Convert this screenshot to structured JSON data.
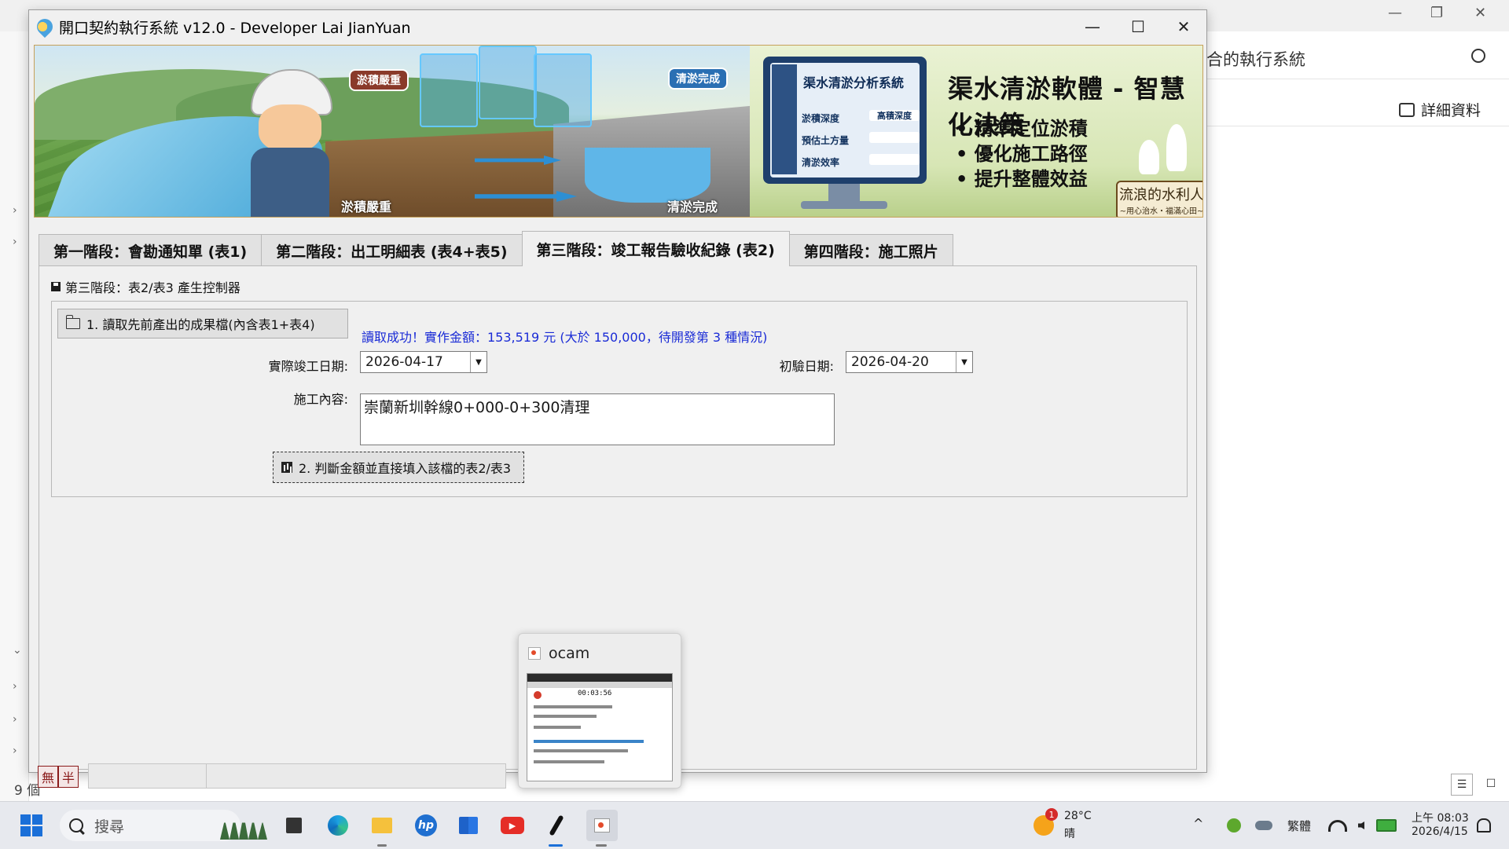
{
  "bg_window": {
    "address_partial": "合的執行系統",
    "details_label": "詳細資料",
    "item_count_partial": "9 個",
    "min_icon": "minimize-icon",
    "restore_icon": "restore-icon",
    "close_icon": "close-icon"
  },
  "app": {
    "title": "開口契約執行系統 v12.0 - Developer Lai JianYuan",
    "minimize": "—",
    "maximize": "☐",
    "close": "✕"
  },
  "banner": {
    "tag_heavy_silt": "淤積嚴重",
    "tag_cleared": "清淤完成",
    "bottom_left_tag": "淤積嚴重",
    "bottom_mid_tag": "清淤完成",
    "monitor_title": "渠水清淤分析系統",
    "monitor_rows": [
      {
        "label": "淤積深度",
        "value": "高積深度"
      },
      {
        "label": "預估土方量",
        "value": ""
      },
      {
        "label": "清淤效率",
        "value": ""
      }
    ],
    "headline": "渠水清淤軟體 - 智慧化決策",
    "bullets": [
      "• 精準定位淤積",
      "• 優化施工路徑",
      "• 提升整體效益"
    ],
    "logo_main": "流浪的水利人",
    "logo_sub": "~用心治水・福滿心田~"
  },
  "tabs": [
    {
      "label": "第一階段：會勘通知單 (表1)",
      "active": false
    },
    {
      "label": "第二階段：出工明細表 (表4+表5)",
      "active": false
    },
    {
      "label": "第三階段：竣工報告驗收紀錄 (表2)",
      "active": true
    },
    {
      "label": "第四階段：施工照片",
      "active": false
    }
  ],
  "stage3": {
    "group_title": "第三階段：表2/表3 產生控制器",
    "load_button": "1. 讀取先前產出的成果檔(內含表1+表4)",
    "status_message": "讀取成功！實作金額：153,519 元 (大於 150,000，待開發第 3 種情況)",
    "actual_completion_label": "實際竣工日期:",
    "actual_completion_value": "2026-04-17",
    "initial_inspection_label": "初驗日期:",
    "initial_inspection_value": "2026-04-20",
    "content_label": "施工內容:",
    "content_value": "崇蘭新圳幹線0+000-0+300清理",
    "fill_button": "2. 判斷金額並直接填入該檔的表2/表3"
  },
  "ime": {
    "mode1": "無",
    "mode2": "半"
  },
  "popup": {
    "app_name": "ocam",
    "thumb_time": "00:03:56"
  },
  "taskbar": {
    "search_placeholder": "搜尋",
    "weather_temp": "28°C",
    "weather_desc": "晴",
    "weather_badge": "1",
    "ime_lang": "繁體",
    "time": "上午 08:03",
    "date": "2026/4/15",
    "tray_chevron": "^"
  }
}
